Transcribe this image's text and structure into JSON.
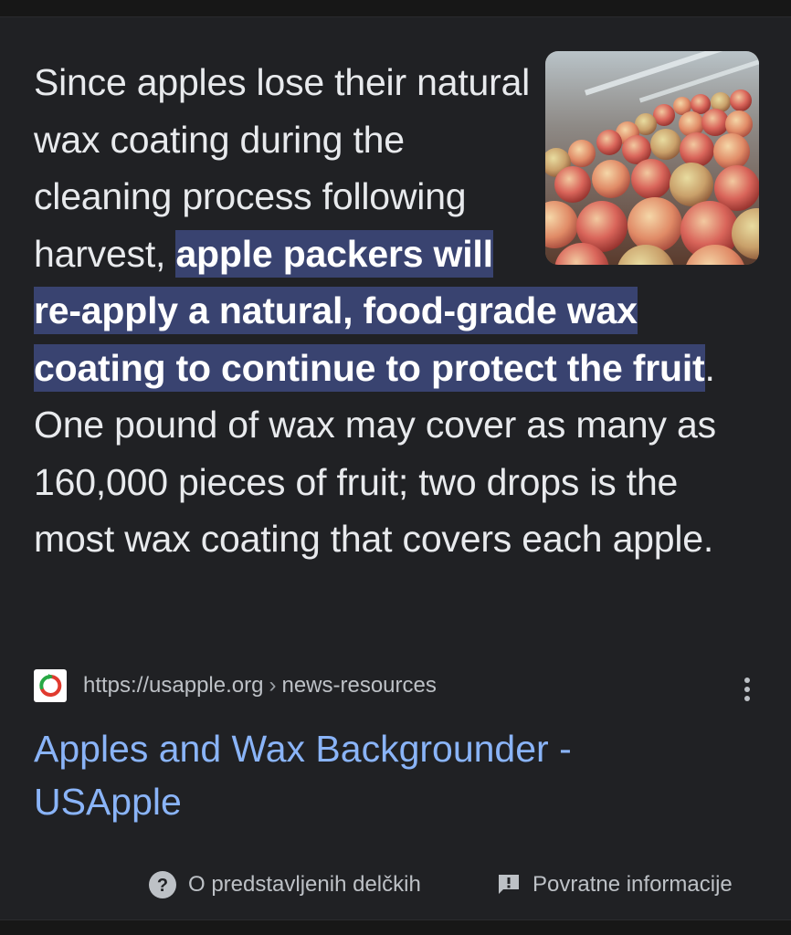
{
  "snippet": {
    "text_before": "Since apples lose their natural wax coating during the cleaning process following harvest, ",
    "text_highlight": "apple packers will re-apply a natural, food-grade wax coating to continue to protect the fruit",
    "text_after": ". One pound of wax may cover as many as 160,000 pieces of fruit; two drops is the most wax coating that covers each apple."
  },
  "thumbnail": {
    "icon": "apples-photo"
  },
  "source": {
    "favicon": "usapple-logo",
    "url": "https://usapple.org",
    "path": "news-resources",
    "separator": "›"
  },
  "result": {
    "title": "Apples and Wax Backgrounder - USApple"
  },
  "footer": {
    "about_label": "O predstavljenih delčkih",
    "feedback_label": "Povratne informacije"
  },
  "colors": {
    "background": "#202124",
    "highlight": "#394370",
    "link": "#8ab4f8",
    "text": "#e8eaed",
    "muted": "#bdc1c6"
  }
}
